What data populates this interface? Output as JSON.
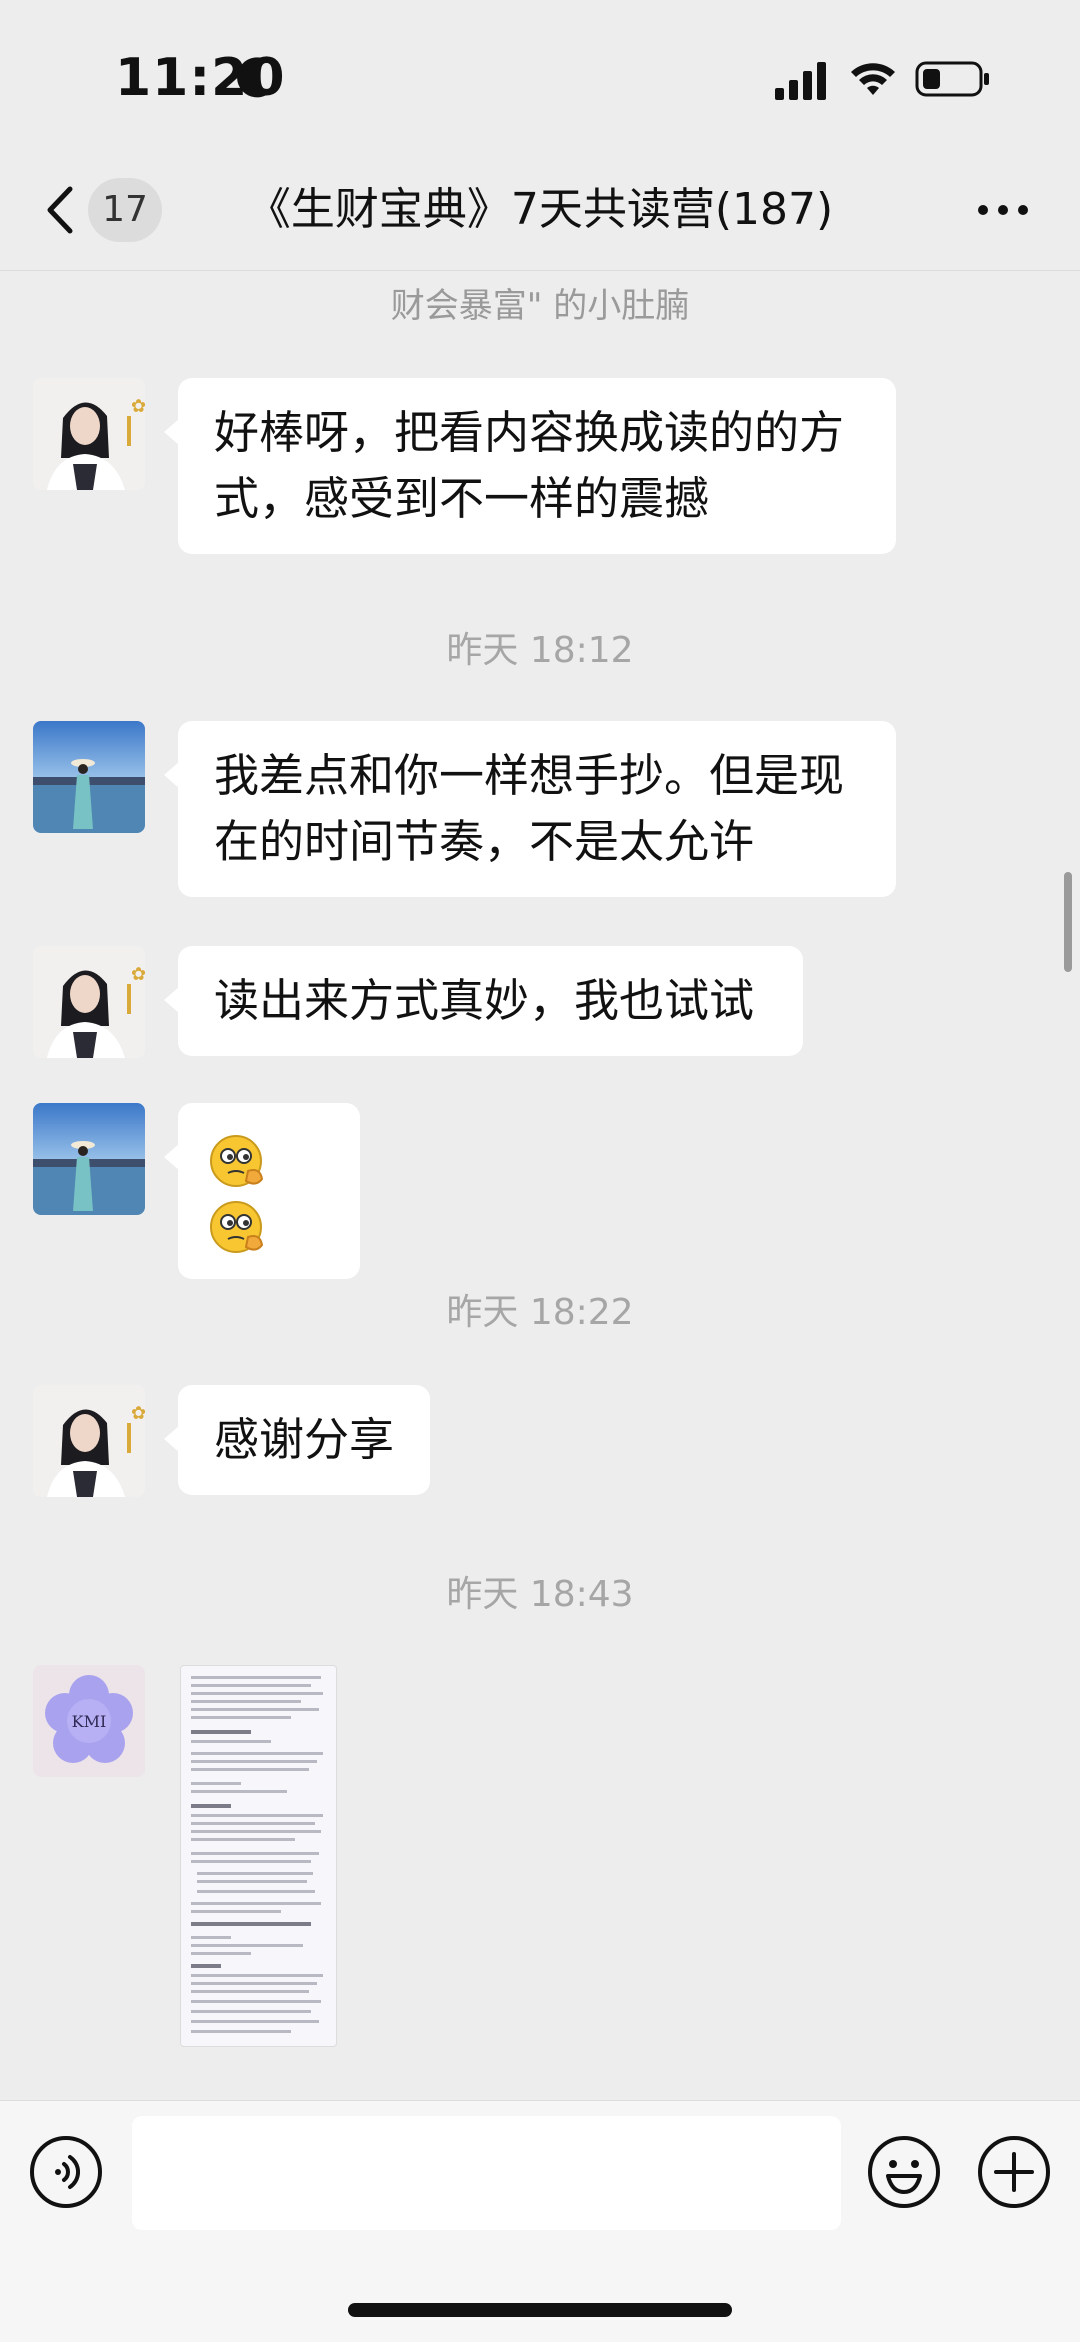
{
  "status_bar": {
    "time": "11:20"
  },
  "header": {
    "unread_count": "17",
    "title": "《生财宝典》7天共读营(187)"
  },
  "chat": {
    "recall_text": "财会暴富\" 的小肚腩",
    "messages": [
      {
        "type": "text",
        "sender": "woman-portrait",
        "text": "好棒呀，把看内容换成读的的方式，感受到不一样的震撼"
      },
      {
        "type": "timestamp",
        "text": "昨天 18:12"
      },
      {
        "type": "text",
        "sender": "lake-photo",
        "text": "我差点和你一样想手抄。但是现在的时间节奏，不是太允许"
      },
      {
        "type": "text",
        "sender": "woman-portrait",
        "text": "读出来方式真妙，我也试试"
      },
      {
        "type": "emoji",
        "sender": "lake-photo",
        "emoji": [
          "thinking-face-emoji",
          "thinking-face-emoji"
        ]
      },
      {
        "type": "timestamp",
        "text": "昨天 18:22"
      },
      {
        "type": "text",
        "sender": "woman-portrait",
        "text": "感谢分享"
      },
      {
        "type": "timestamp",
        "text": "昨天 18:43"
      },
      {
        "type": "image",
        "sender": "kmi-flower",
        "avatar_text": "KMI"
      }
    ]
  },
  "colors": {
    "background": "#ededed",
    "bubble": "#ffffff",
    "timestamp": "#a6a6a6"
  }
}
